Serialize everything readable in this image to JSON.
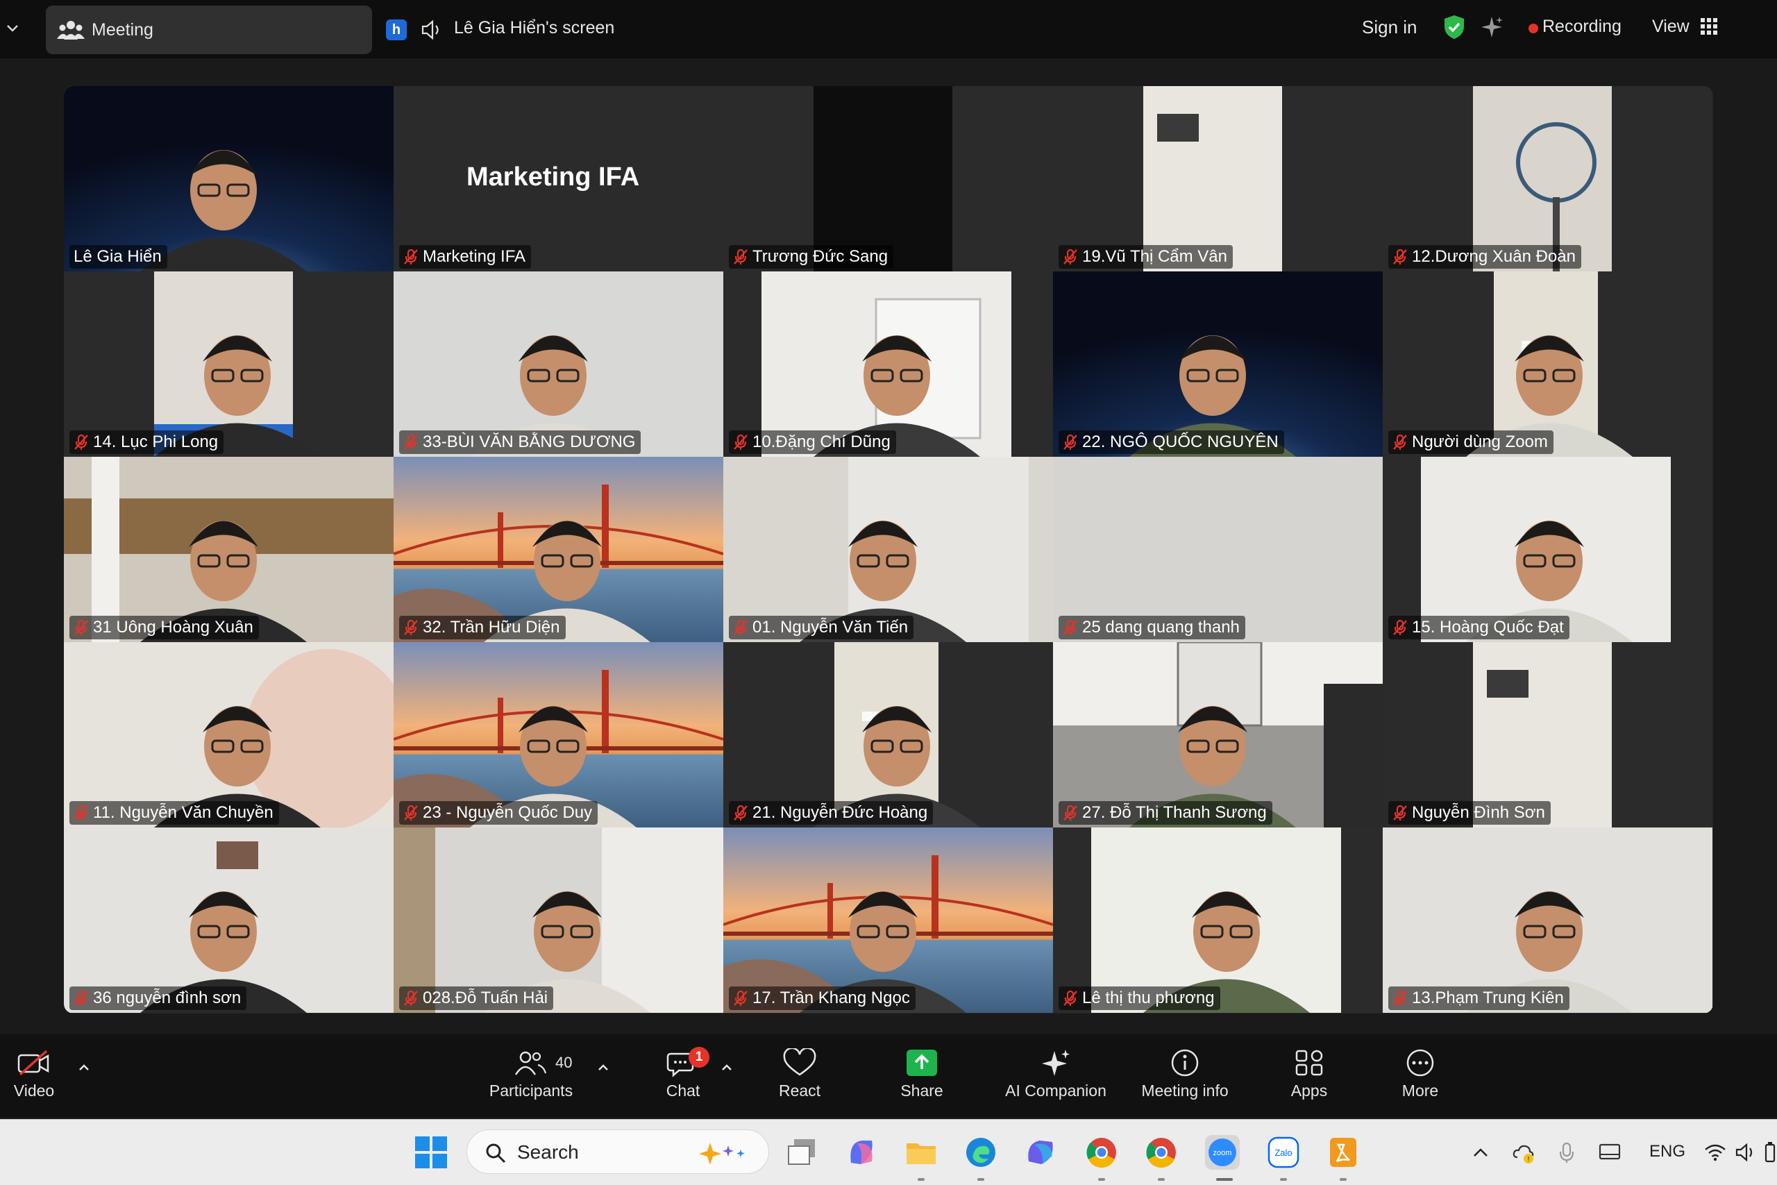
{
  "topbar": {
    "meeting_label": "Meeting",
    "screen_badge": "h",
    "screen_label": "Lê Gia Hiển's screen",
    "sign_in": "Sign in",
    "recording": "Recording",
    "view": "View",
    "recording_color": "#e5332a",
    "shield_color": "#2fb84a"
  },
  "gallery": {
    "shared_title": "Marketing IFA",
    "tiles": [
      {
        "name": "Lê Gia Hiển",
        "muted": false,
        "active": true
      },
      {
        "name": "Marketing IFA",
        "muted": true
      },
      {
        "name": "Trương Đức Sang",
        "muted": true
      },
      {
        "name": "19.Vũ Thị Cẩm Vân",
        "muted": true
      },
      {
        "name": "12.Dương Xuân Đoàn",
        "muted": true
      },
      {
        "name": "14. Lục Phi Long",
        "muted": true
      },
      {
        "name": "33-BÙI VĂN BẰNG DƯƠNG",
        "muted": true
      },
      {
        "name": "10.Đặng Chí Dũng",
        "muted": true
      },
      {
        "name": "22. NGÔ QUỐC NGUYÊN",
        "muted": true
      },
      {
        "name": "Người dùng Zoom",
        "muted": true
      },
      {
        "name": "31 Uông Hoàng Xuân",
        "muted": true
      },
      {
        "name": "32. Trần Hữu Diện",
        "muted": true
      },
      {
        "name": "01. Nguyễn Văn Tiến",
        "muted": true
      },
      {
        "name": "25 dang quang thanh",
        "muted": true
      },
      {
        "name": "15. Hoàng Quốc Đạt",
        "muted": true
      },
      {
        "name": "11. Nguyễn Văn Chuyền",
        "muted": true
      },
      {
        "name": "23 - Nguyễn Quốc Duy",
        "muted": true
      },
      {
        "name": "21. Nguyễn Đức Hoàng",
        "muted": true
      },
      {
        "name": "27. Đỗ Thị Thanh Sương",
        "muted": true
      },
      {
        "name": "Nguyễn Đình Sơn",
        "muted": true
      },
      {
        "name": "36 nguyễn đình sơn",
        "muted": true
      },
      {
        "name": "028.Đỗ Tuấn Hải",
        "muted": true
      },
      {
        "name": "17. Trần Khang Ngọc",
        "muted": true
      },
      {
        "name": "Lê thị thu phương",
        "muted": true
      },
      {
        "name": "13.Phạm Trung Kiên",
        "muted": true
      }
    ]
  },
  "toolbar": {
    "video": "Video",
    "participants": "Participants",
    "participant_count": "40",
    "chat": "Chat",
    "chat_badge": "1",
    "react": "React",
    "share": "Share",
    "ai_companion": "AI Companion",
    "meeting_info": "Meeting info",
    "apps": "Apps",
    "more": "More",
    "share_color": "#1fb34f",
    "badge_color": "#e5332a"
  },
  "taskbar": {
    "search": "Search",
    "language": "ENG"
  }
}
